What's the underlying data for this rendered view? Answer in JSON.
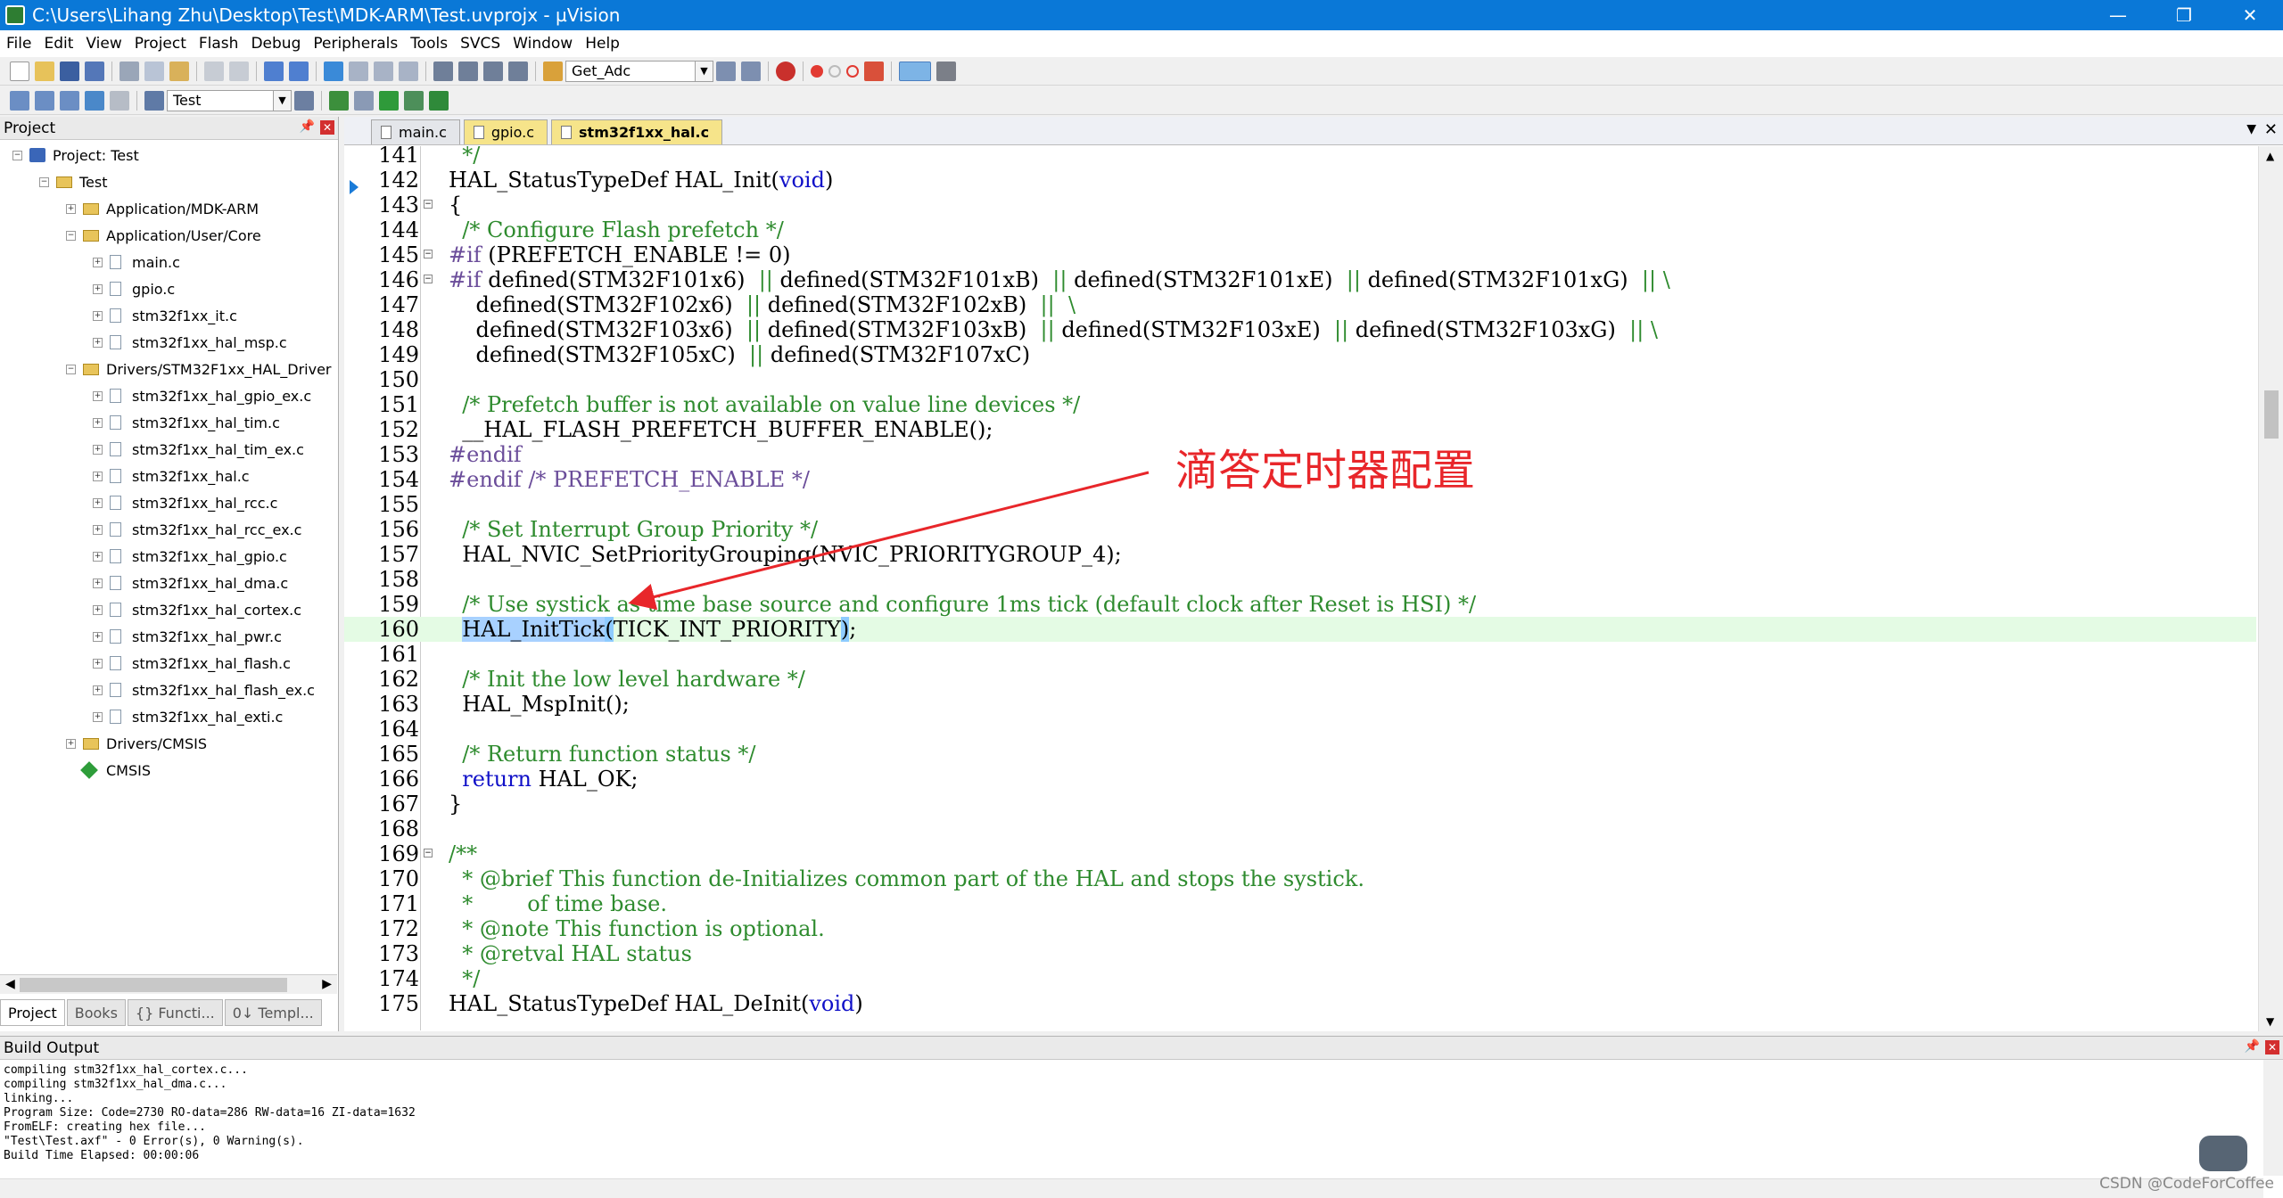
{
  "window": {
    "title": "C:\\Users\\Lihang Zhu\\Desktop\\Test\\MDK-ARM\\Test.uvprojx - µVision",
    "minimize": "—",
    "maximize": "❐",
    "close": "✕"
  },
  "menu": [
    "File",
    "Edit",
    "View",
    "Project",
    "Flash",
    "Debug",
    "Peripherals",
    "Tools",
    "SVCS",
    "Window",
    "Help"
  ],
  "toolbar": {
    "function_combo": "Get_Adc",
    "target_combo": "Test"
  },
  "project_panel": {
    "title": "Project",
    "tree": [
      {
        "label": "Project: Test",
        "level": 0,
        "kind": "proj",
        "exp": "−"
      },
      {
        "label": "Test",
        "level": 1,
        "kind": "folder",
        "exp": "−"
      },
      {
        "label": "Application/MDK-ARM",
        "level": 2,
        "kind": "folder",
        "exp": "+"
      },
      {
        "label": "Application/User/Core",
        "level": 2,
        "kind": "folder",
        "exp": "−"
      },
      {
        "label": "main.c",
        "level": 3,
        "kind": "file",
        "exp": "+"
      },
      {
        "label": "gpio.c",
        "level": 3,
        "kind": "file",
        "exp": "+"
      },
      {
        "label": "stm32f1xx_it.c",
        "level": 3,
        "kind": "file",
        "exp": "+"
      },
      {
        "label": "stm32f1xx_hal_msp.c",
        "level": 3,
        "kind": "file",
        "exp": "+"
      },
      {
        "label": "Drivers/STM32F1xx_HAL_Driver",
        "level": 2,
        "kind": "folder",
        "exp": "−"
      },
      {
        "label": "stm32f1xx_hal_gpio_ex.c",
        "level": 3,
        "kind": "file",
        "exp": "+"
      },
      {
        "label": "stm32f1xx_hal_tim.c",
        "level": 3,
        "kind": "file",
        "exp": "+"
      },
      {
        "label": "stm32f1xx_hal_tim_ex.c",
        "level": 3,
        "kind": "file",
        "exp": "+"
      },
      {
        "label": "stm32f1xx_hal.c",
        "level": 3,
        "kind": "file",
        "exp": "+"
      },
      {
        "label": "stm32f1xx_hal_rcc.c",
        "level": 3,
        "kind": "file",
        "exp": "+"
      },
      {
        "label": "stm32f1xx_hal_rcc_ex.c",
        "level": 3,
        "kind": "file",
        "exp": "+"
      },
      {
        "label": "stm32f1xx_hal_gpio.c",
        "level": 3,
        "kind": "file",
        "exp": "+"
      },
      {
        "label": "stm32f1xx_hal_dma.c",
        "level": 3,
        "kind": "file",
        "exp": "+"
      },
      {
        "label": "stm32f1xx_hal_cortex.c",
        "level": 3,
        "kind": "file",
        "exp": "+"
      },
      {
        "label": "stm32f1xx_hal_pwr.c",
        "level": 3,
        "kind": "file",
        "exp": "+"
      },
      {
        "label": "stm32f1xx_hal_flash.c",
        "level": 3,
        "kind": "file",
        "exp": "+"
      },
      {
        "label": "stm32f1xx_hal_flash_ex.c",
        "level": 3,
        "kind": "file",
        "exp": "+"
      },
      {
        "label": "stm32f1xx_hal_exti.c",
        "level": 3,
        "kind": "file",
        "exp": "+"
      },
      {
        "label": "Drivers/CMSIS",
        "level": 2,
        "kind": "folder",
        "exp": "+"
      },
      {
        "label": "CMSIS",
        "level": 2,
        "kind": "green",
        "exp": ""
      }
    ],
    "tabs": [
      "Project",
      "Books",
      "{} Functi...",
      "0↓ Templ..."
    ]
  },
  "editor": {
    "tabs": [
      "main.c",
      "gpio.c",
      "stm32f1xx_hal.c"
    ],
    "active_tab": "stm32f1xx_hal.c",
    "lines": [
      {
        "n": "141",
        "fold": "",
        "hl": false,
        "seg": [
          [
            "c",
            "  */"
          ]
        ]
      },
      {
        "n": "142",
        "fold": "",
        "hl": false,
        "seg": [
          [
            "t",
            "HAL_StatusTypeDef HAL_Init("
          ],
          [
            "k",
            "void"
          ],
          [
            "t",
            ")"
          ]
        ]
      },
      {
        "n": "143",
        "fold": "−",
        "hl": false,
        "seg": [
          [
            "t",
            "{"
          ]
        ]
      },
      {
        "n": "144",
        "fold": "",
        "hl": false,
        "seg": [
          [
            "c",
            "  /* Configure Flash prefetch */"
          ]
        ]
      },
      {
        "n": "145",
        "fold": "−",
        "hl": false,
        "seg": [
          [
            "p",
            "#if"
          ],
          [
            "t",
            " (PREFETCH_ENABLE != 0)"
          ]
        ]
      },
      {
        "n": "146",
        "fold": "−",
        "hl": false,
        "seg": [
          [
            "p",
            "#if"
          ],
          [
            "t",
            " defined(STM32F101x6)  "
          ],
          [
            "c",
            "||"
          ],
          [
            "t",
            " defined(STM32F101xB)  "
          ],
          [
            "c",
            "||"
          ],
          [
            "t",
            " defined(STM32F101xE)  "
          ],
          [
            "c",
            "||"
          ],
          [
            "t",
            " defined(STM32F101xG)  "
          ],
          [
            "c",
            "|| \\"
          ]
        ]
      },
      {
        "n": "147",
        "fold": "",
        "hl": false,
        "seg": [
          [
            "t",
            "    defined(STM32F102x6)  "
          ],
          [
            "c",
            "||"
          ],
          [
            "t",
            " defined(STM32F102xB)  "
          ],
          [
            "c",
            "||"
          ],
          [
            "t",
            "  "
          ],
          [
            "c",
            "\\"
          ]
        ]
      },
      {
        "n": "148",
        "fold": "",
        "hl": false,
        "seg": [
          [
            "t",
            "    defined(STM32F103x6)  "
          ],
          [
            "c",
            "||"
          ],
          [
            "t",
            " defined(STM32F103xB)  "
          ],
          [
            "c",
            "||"
          ],
          [
            "t",
            " defined(STM32F103xE)  "
          ],
          [
            "c",
            "||"
          ],
          [
            "t",
            " defined(STM32F103xG)  "
          ],
          [
            "c",
            "|| \\"
          ]
        ]
      },
      {
        "n": "149",
        "fold": "",
        "hl": false,
        "seg": [
          [
            "t",
            "    defined(STM32F105xC)  "
          ],
          [
            "c",
            "||"
          ],
          [
            "t",
            " defined(STM32F107xC)"
          ]
        ]
      },
      {
        "n": "150",
        "fold": "",
        "hl": false,
        "seg": [
          [
            "t",
            ""
          ]
        ]
      },
      {
        "n": "151",
        "fold": "",
        "hl": false,
        "seg": [
          [
            "c",
            "  /* Prefetch buffer is not available on value line devices */"
          ]
        ]
      },
      {
        "n": "152",
        "fold": "",
        "hl": false,
        "seg": [
          [
            "t",
            "  __HAL_FLASH_PREFETCH_BUFFER_ENABLE();"
          ]
        ]
      },
      {
        "n": "153",
        "fold": "",
        "hl": false,
        "seg": [
          [
            "p",
            "#endif"
          ]
        ]
      },
      {
        "n": "154",
        "fold": "",
        "hl": false,
        "seg": [
          [
            "p",
            "#endif /* PREFETCH_ENABLE */"
          ]
        ]
      },
      {
        "n": "155",
        "fold": "",
        "hl": false,
        "seg": [
          [
            "t",
            ""
          ]
        ]
      },
      {
        "n": "156",
        "fold": "",
        "hl": false,
        "seg": [
          [
            "c",
            "  /* Set Interrupt Group Priority */"
          ]
        ]
      },
      {
        "n": "157",
        "fold": "",
        "hl": false,
        "seg": [
          [
            "t",
            "  HAL_NVIC_SetPriorityGrouping(NVIC_PRIORITYGROUP_4);"
          ]
        ]
      },
      {
        "n": "158",
        "fold": "",
        "hl": false,
        "seg": [
          [
            "t",
            ""
          ]
        ]
      },
      {
        "n": "159",
        "fold": "",
        "hl": false,
        "seg": [
          [
            "c",
            "  /* Use systick as time base source and configure 1ms tick (default clock after Reset is HSI) */"
          ]
        ]
      },
      {
        "n": "160",
        "fold": "",
        "hl": true,
        "seg": [
          [
            "t",
            "  "
          ],
          [
            "s",
            "HAL_InitTick"
          ],
          [
            "b",
            "("
          ],
          [
            "t",
            "TICK_INT_PRIORITY"
          ],
          [
            "b",
            ")"
          ],
          [
            "t",
            ";"
          ]
        ]
      },
      {
        "n": "161",
        "fold": "",
        "hl": false,
        "seg": [
          [
            "t",
            ""
          ]
        ]
      },
      {
        "n": "162",
        "fold": "",
        "hl": false,
        "seg": [
          [
            "c",
            "  /* Init the low level hardware */"
          ]
        ]
      },
      {
        "n": "163",
        "fold": "",
        "hl": false,
        "seg": [
          [
            "t",
            "  HAL_MspInit();"
          ]
        ]
      },
      {
        "n": "164",
        "fold": "",
        "hl": false,
        "seg": [
          [
            "t",
            ""
          ]
        ]
      },
      {
        "n": "165",
        "fold": "",
        "hl": false,
        "seg": [
          [
            "c",
            "  /* Return function status */"
          ]
        ]
      },
      {
        "n": "166",
        "fold": "",
        "hl": false,
        "seg": [
          [
            "t",
            "  "
          ],
          [
            "k",
            "return"
          ],
          [
            "t",
            " HAL_OK;"
          ]
        ]
      },
      {
        "n": "167",
        "fold": "",
        "hl": false,
        "seg": [
          [
            "t",
            "}"
          ]
        ]
      },
      {
        "n": "168",
        "fold": "",
        "hl": false,
        "seg": [
          [
            "t",
            ""
          ]
        ]
      },
      {
        "n": "169",
        "fold": "−",
        "hl": false,
        "seg": [
          [
            "c",
            "/**"
          ]
        ]
      },
      {
        "n": "170",
        "fold": "",
        "hl": false,
        "seg": [
          [
            "c",
            "  * @brief This function de-Initializes common part of the HAL and stops the systick."
          ]
        ]
      },
      {
        "n": "171",
        "fold": "",
        "hl": false,
        "seg": [
          [
            "c",
            "  *        of time base."
          ]
        ]
      },
      {
        "n": "172",
        "fold": "",
        "hl": false,
        "seg": [
          [
            "c",
            "  * @note This function is optional."
          ]
        ]
      },
      {
        "n": "173",
        "fold": "",
        "hl": false,
        "seg": [
          [
            "c",
            "  * @retval HAL status"
          ]
        ]
      },
      {
        "n": "174",
        "fold": "",
        "hl": false,
        "seg": [
          [
            "c",
            "  */"
          ]
        ]
      },
      {
        "n": "175",
        "fold": "",
        "hl": false,
        "seg": [
          [
            "t",
            "HAL_StatusTypeDef HAL_DeInit("
          ],
          [
            "k",
            "void"
          ],
          [
            "t",
            ")"
          ]
        ]
      }
    ]
  },
  "annotation": "滴答定时器配置",
  "build_output": {
    "title": "Build Output",
    "lines": [
      "compiling stm32f1xx_hal_cortex.c...",
      "compiling stm32f1xx_hal_dma.c...",
      "linking...",
      "Program Size: Code=2730 RO-data=286 RW-data=16 ZI-data=1632",
      "FromELF: creating hex file...",
      "\"Test\\Test.axf\" - 0 Error(s), 0 Warning(s).",
      "Build Time Elapsed:  00:00:06"
    ]
  },
  "watermark": "CSDN @CodeForCoffee",
  "colors": {
    "titlebar": "#0a78d7",
    "comment": "#2e8b2e",
    "keyword": "#1010c8",
    "preprocessor": "#6b4d9a",
    "annotation": "#e8262a",
    "current_line": "#e4fbe4"
  }
}
